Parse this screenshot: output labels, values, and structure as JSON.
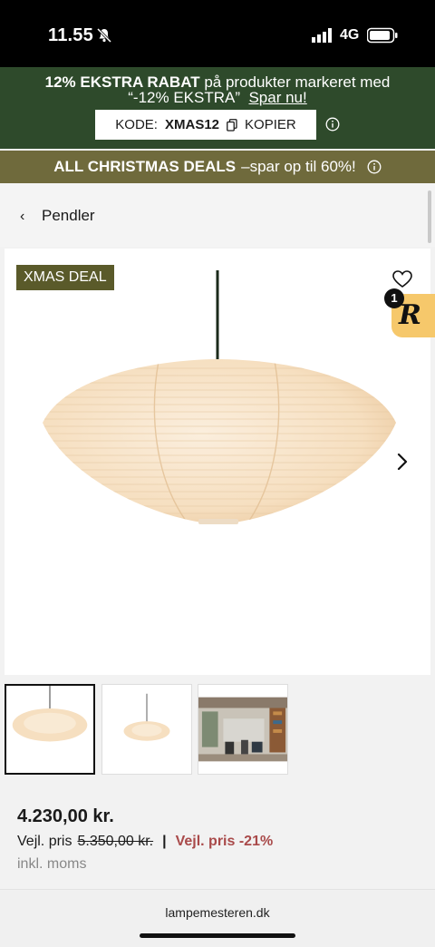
{
  "status_bar": {
    "time": "11.55",
    "network": "4G",
    "icons": [
      "mute-bell-icon",
      "signal-icon",
      "battery-icon"
    ]
  },
  "promo": {
    "bold": "12% EKSTRA RABAT",
    "text_after_bold": " på produkter markeret med",
    "line2": "“-12% EKSTRA”",
    "link": "Spar nu!",
    "code_label": "KODE:",
    "code_value": "XMAS12",
    "copy_label": "KOPIER",
    "background": "#2e4a2b"
  },
  "deals": {
    "bold": "ALL CHRISTMAS DEALS",
    "text": "–spar op til 60%!",
    "background": "#6f6a3c"
  },
  "breadcrumb": {
    "label": "Pendler"
  },
  "gallery": {
    "badge": "XMAS DEAL",
    "icons": [
      "heart-icon",
      "chevron-right-icon"
    ]
  },
  "widget": {
    "letter": "R",
    "count": "1",
    "color": "#f6c86b"
  },
  "price": {
    "current": "4.230,00 kr.",
    "rrp_label": "Vejl. pris",
    "rrp_old": "5.350,00 kr.",
    "separator": "|",
    "rrp_discount": "Vejl. pris -21%",
    "vat_note": "inkl. moms",
    "discount_color": "#a94a4a"
  },
  "browser": {
    "url": "lampemesteren.dk"
  }
}
